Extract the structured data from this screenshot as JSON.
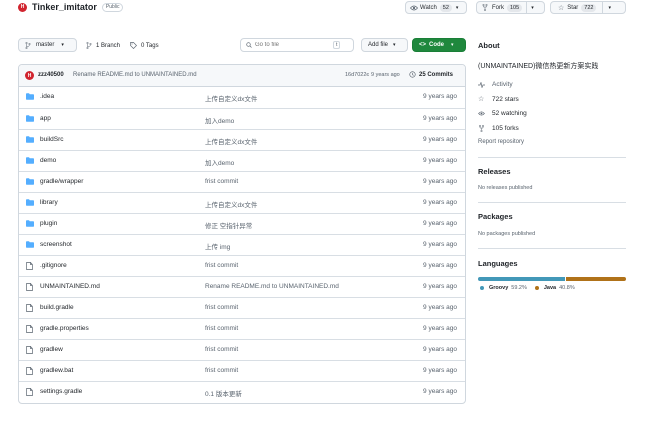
{
  "repo": {
    "name": "Tinker_imitator",
    "avatar_letter": "H",
    "visibility": "Public"
  },
  "actions": {
    "watch": {
      "label": "Watch",
      "count": "52"
    },
    "fork": {
      "label": "Fork",
      "count": "105"
    },
    "star": {
      "label": "Star",
      "count": "722"
    }
  },
  "toolbar": {
    "branch": "master",
    "branches": "1 Branch",
    "tags": "0 Tags",
    "search_placeholder": "Go to file",
    "search_shortcut": "t",
    "add_file": "Add file",
    "code": "Code"
  },
  "latest_commit": {
    "author": "zzz40500",
    "message": "Rename README.md to UNMAINTAINED.md",
    "hash": "16d7022c",
    "time": "9 years ago",
    "commits": "25 Commits"
  },
  "files": [
    {
      "name": ".idea",
      "type": "folder",
      "message": "上传自定义dx文件",
      "time": "9 years ago"
    },
    {
      "name": "app",
      "type": "folder",
      "message": "加入demo",
      "time": "9 years ago"
    },
    {
      "name": "buildSrc",
      "type": "folder",
      "message": "上传自定义dx文件",
      "time": "9 years ago"
    },
    {
      "name": "demo",
      "type": "folder",
      "message": "加入demo",
      "time": "9 years ago"
    },
    {
      "name": "gradle/wrapper",
      "type": "folder",
      "message": "frist commit",
      "time": "9 years ago"
    },
    {
      "name": "library",
      "type": "folder",
      "message": "上传自定义dx文件",
      "time": "9 years ago"
    },
    {
      "name": "plugin",
      "type": "folder",
      "message": "修正 空指针异常",
      "time": "9 years ago"
    },
    {
      "name": "screenshot",
      "type": "folder",
      "message": "上传 img",
      "time": "9 years ago"
    },
    {
      "name": ".gitignore",
      "type": "file",
      "message": "frist commit",
      "time": "9 years ago"
    },
    {
      "name": "UNMAINTAINED.md",
      "type": "file",
      "message": "Rename README.md to UNMAINTAINED.md",
      "time": "9 years ago"
    },
    {
      "name": "build.gradle",
      "type": "file",
      "message": "frist commit",
      "time": "9 years ago"
    },
    {
      "name": "gradle.properties",
      "type": "file",
      "message": "frist commit",
      "time": "9 years ago"
    },
    {
      "name": "gradlew",
      "type": "file",
      "message": "frist commit",
      "time": "9 years ago"
    },
    {
      "name": "gradlew.bat",
      "type": "file",
      "message": "frist commit",
      "time": "9 years ago"
    },
    {
      "name": "settings.gradle",
      "type": "file",
      "message": "0.1 版本更新",
      "time": "9 years ago"
    }
  ],
  "about": {
    "title": "About",
    "description": "(UNMAINTAINED)微信热更新方案实践",
    "activity": "Activity",
    "stars": "722 stars",
    "watching": "52 watching",
    "forks": "105 forks",
    "report": "Report repository"
  },
  "releases": {
    "title": "Releases",
    "text": "No releases published"
  },
  "packages": {
    "title": "Packages",
    "text": "No packages published"
  },
  "languages": {
    "title": "Languages",
    "items": [
      {
        "name": "Groovy",
        "percent": "59.2%",
        "value": 59.2,
        "color": "#4298b8"
      },
      {
        "name": "Java",
        "percent": "40.8%",
        "value": 40.8,
        "color": "#b07219"
      }
    ]
  },
  "colors": {
    "code_button": "#1f883d",
    "folder": "#54aeff",
    "link": "#0969da"
  }
}
